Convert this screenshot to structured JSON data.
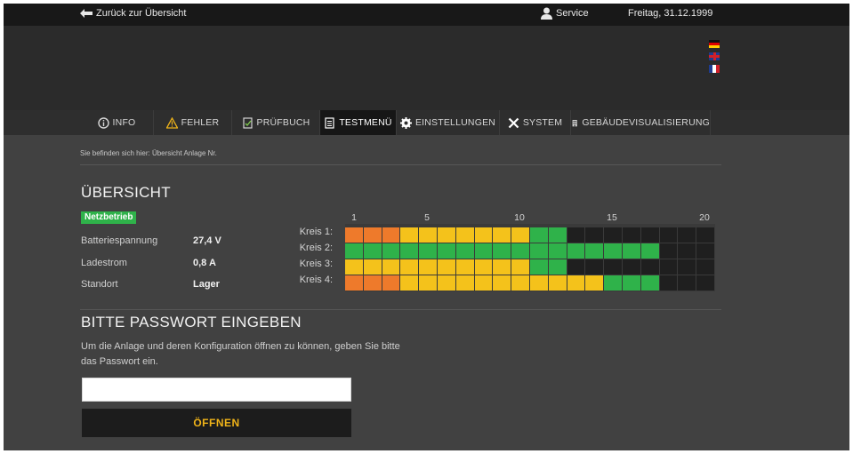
{
  "topbar": {
    "back_label": "Zurück zur Übersicht",
    "service_label": "Service",
    "date": "Freitag, 31.12.1999"
  },
  "languages": [
    {
      "icon": "flag-de-icon"
    },
    {
      "icon": "flag-uk-icon"
    },
    {
      "icon": "flag-fr-icon"
    }
  ],
  "nav": {
    "tabs": [
      {
        "label": "INFO",
        "icon": "info-icon",
        "active": false
      },
      {
        "label": "FEHLER",
        "icon": "warning-icon",
        "active": false
      },
      {
        "label": "PRÜFBUCH",
        "icon": "logbook-icon",
        "active": false
      },
      {
        "label": "TESTMENÜ",
        "icon": "test-menu-icon",
        "active": true
      },
      {
        "label": "EINSTELLUNGEN",
        "icon": "gear-icon",
        "active": false
      },
      {
        "label": "SYSTEM",
        "icon": "tools-icon",
        "active": false
      },
      {
        "label": "GEBÄUDEVISUALISIERUNG",
        "icon": "building-icon",
        "active": false
      }
    ]
  },
  "breadcrumb": "Sie befinden sich hier: Übersicht Anlage Nr.",
  "overview": {
    "title": "ÜBERSICHT",
    "status_badge": "Netzbetrieb",
    "status_color": "#2fb24a",
    "rows": [
      {
        "label": "Batteriespannung",
        "value": "27,4 V"
      },
      {
        "label": "Ladestrom",
        "value": "0,8 A"
      },
      {
        "label": "Standort",
        "value": "Lager"
      }
    ]
  },
  "circuits": {
    "ticks": [
      "1",
      "5",
      "10",
      "15",
      "20"
    ],
    "legend_colors": {
      "empty": "#1f1f1f",
      "green": "#2fb24a",
      "yellow": "#f4c21b",
      "orange": "#ee7a2b"
    },
    "rows": [
      {
        "label": "Kreis 1:",
        "cells": [
          3,
          3,
          3,
          2,
          2,
          2,
          2,
          2,
          2,
          2,
          1,
          1,
          0,
          0,
          0,
          0,
          0,
          0,
          0,
          0
        ]
      },
      {
        "label": "Kreis 2:",
        "cells": [
          1,
          1,
          1,
          1,
          1,
          1,
          1,
          1,
          1,
          1,
          1,
          1,
          1,
          1,
          1,
          1,
          1,
          0,
          0,
          0
        ]
      },
      {
        "label": "Kreis 3:",
        "cells": [
          2,
          2,
          2,
          2,
          2,
          2,
          2,
          2,
          2,
          2,
          1,
          1,
          0,
          0,
          0,
          0,
          0,
          0,
          0,
          0
        ]
      },
      {
        "label": "Kreis 4:",
        "cells": [
          3,
          3,
          3,
          2,
          2,
          2,
          2,
          2,
          2,
          2,
          2,
          2,
          2,
          2,
          1,
          1,
          1,
          0,
          0,
          0
        ]
      }
    ]
  },
  "password": {
    "title": "BITTE PASSWORT EINGEBEN",
    "text": "Um die Anlage und deren Konfiguration öffnen zu können, geben Sie bitte das Passwort ein.",
    "input_value": "",
    "button_label": "ÖFFNEN",
    "button_text_color": "#f0b419"
  }
}
